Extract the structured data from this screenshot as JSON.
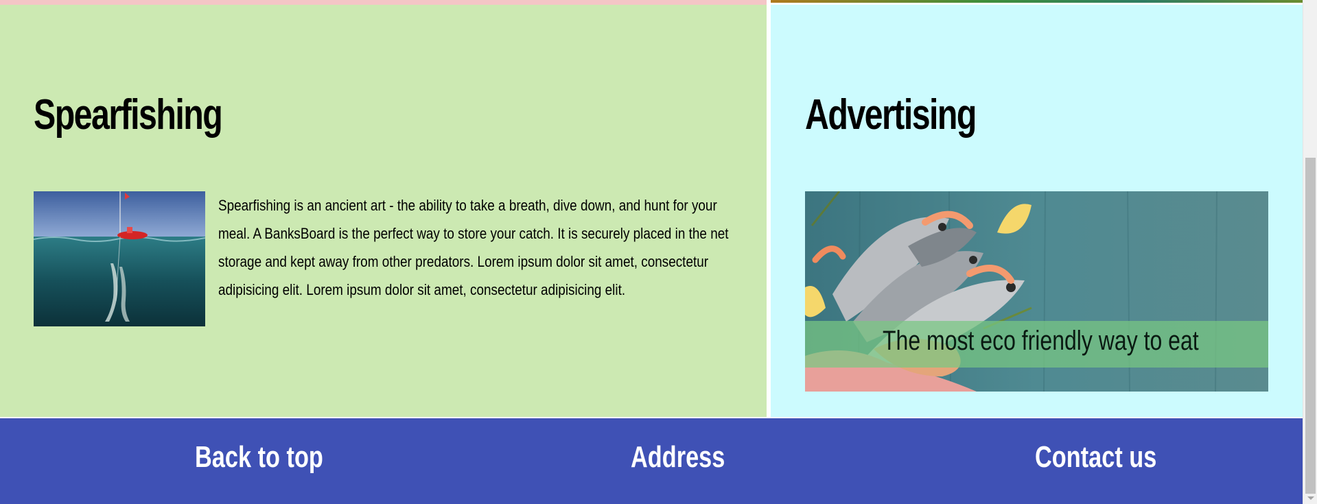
{
  "sections": {
    "spearfishing": {
      "title": "Spearfishing",
      "body": "Spearfishing is an ancient art - the ability to take a breath, dive down, and hunt for your meal. A BanksBoard is the perfect way to store your catch. It is securely placed in the net storage and kept away from other predators. Lorem ipsum dolor sit amet, consectetur adipisicing elit. Lorem ipsum dolor sit amet, consectetur adipisicing elit."
    },
    "advertising": {
      "title": "Advertising",
      "caption": "The most eco friendly way to eat"
    }
  },
  "footer": {
    "back_to_top": "Back to top",
    "address": "Address",
    "contact": "Contact us"
  },
  "colors": {
    "left_panel": "#cce9b2",
    "right_panel": "#ccfbfe",
    "footer": "#3f51b5"
  }
}
